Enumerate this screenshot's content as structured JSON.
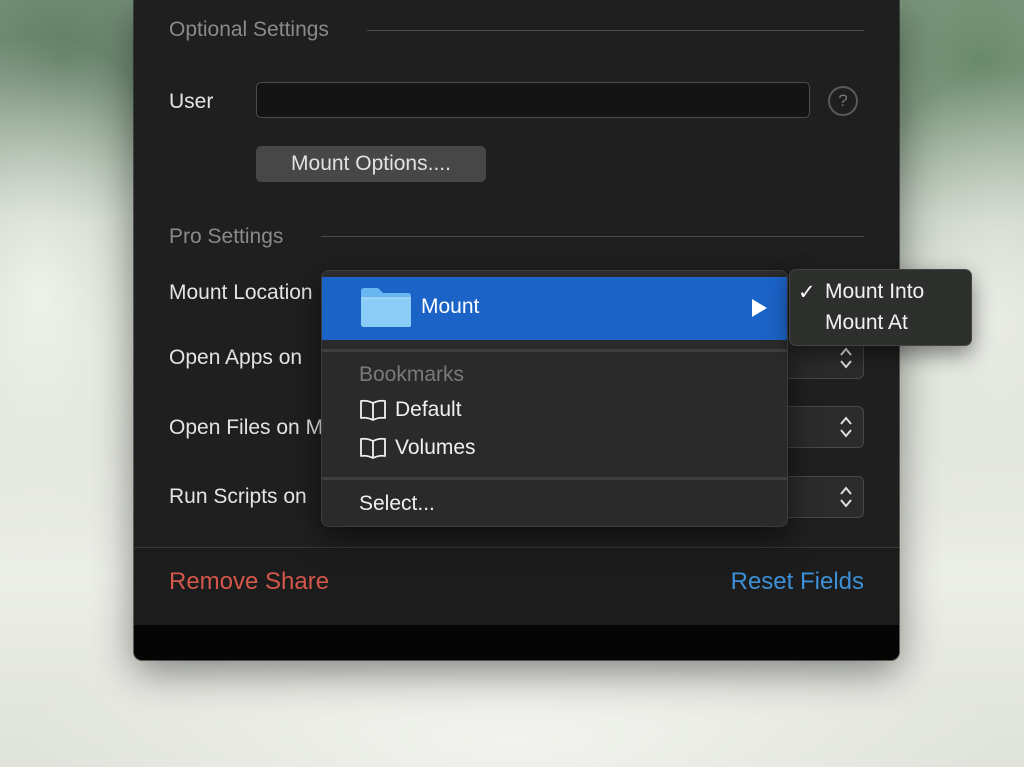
{
  "optional_settings": {
    "section_label": "Optional Settings",
    "user_label": "User",
    "user_value": "",
    "help_label": "?",
    "mount_options_label": "Mount Options...."
  },
  "pro_settings": {
    "section_label": "Pro Settings",
    "rows": [
      {
        "label": "Mount Location"
      },
      {
        "label": "Open Apps on"
      },
      {
        "label": "Open Files on M"
      },
      {
        "label": "Run Scripts on"
      }
    ]
  },
  "menu": {
    "mount_item": {
      "label": "Mount",
      "icon": "folder-icon"
    },
    "bookmarks_heading": "Bookmarks",
    "bookmarks": [
      {
        "label": "Default",
        "icon": "book-icon"
      },
      {
        "label": "Volumes",
        "icon": "book-icon"
      }
    ],
    "select_label": "Select..."
  },
  "submenu": {
    "checkmark": "✓",
    "items": [
      {
        "label": "Mount Into",
        "checked": true
      },
      {
        "label": "Mount At",
        "checked": false
      }
    ]
  },
  "footer": {
    "remove_label": "Remove Share",
    "reset_label": "Reset Fields"
  },
  "colors": {
    "accent_blue": "#1c63c8",
    "remove_red": "#d4574b",
    "reset_blue": "#3d8fd6",
    "panel_bg": "#1f1f1f"
  }
}
